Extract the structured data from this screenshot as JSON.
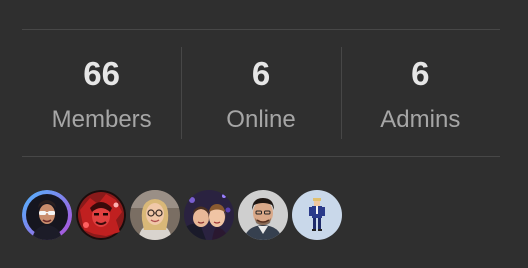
{
  "stats": [
    {
      "value": "66",
      "label": "Members"
    },
    {
      "value": "6",
      "label": "Online"
    },
    {
      "value": "6",
      "label": "Admins"
    }
  ],
  "avatars": [
    {
      "icon": "person-with-sunglasses-avatar"
    },
    {
      "icon": "person-red-art-avatar"
    },
    {
      "icon": "person-blonde-glasses-avatar"
    },
    {
      "icon": "couple-selfie-avatar"
    },
    {
      "icon": "man-portrait-avatar"
    },
    {
      "icon": "pixel-person-avatar"
    }
  ],
  "colors": {
    "background": "#2f2f2f",
    "divider": "#474747",
    "value": "#e6e6e6",
    "label": "#a6a6a6"
  }
}
